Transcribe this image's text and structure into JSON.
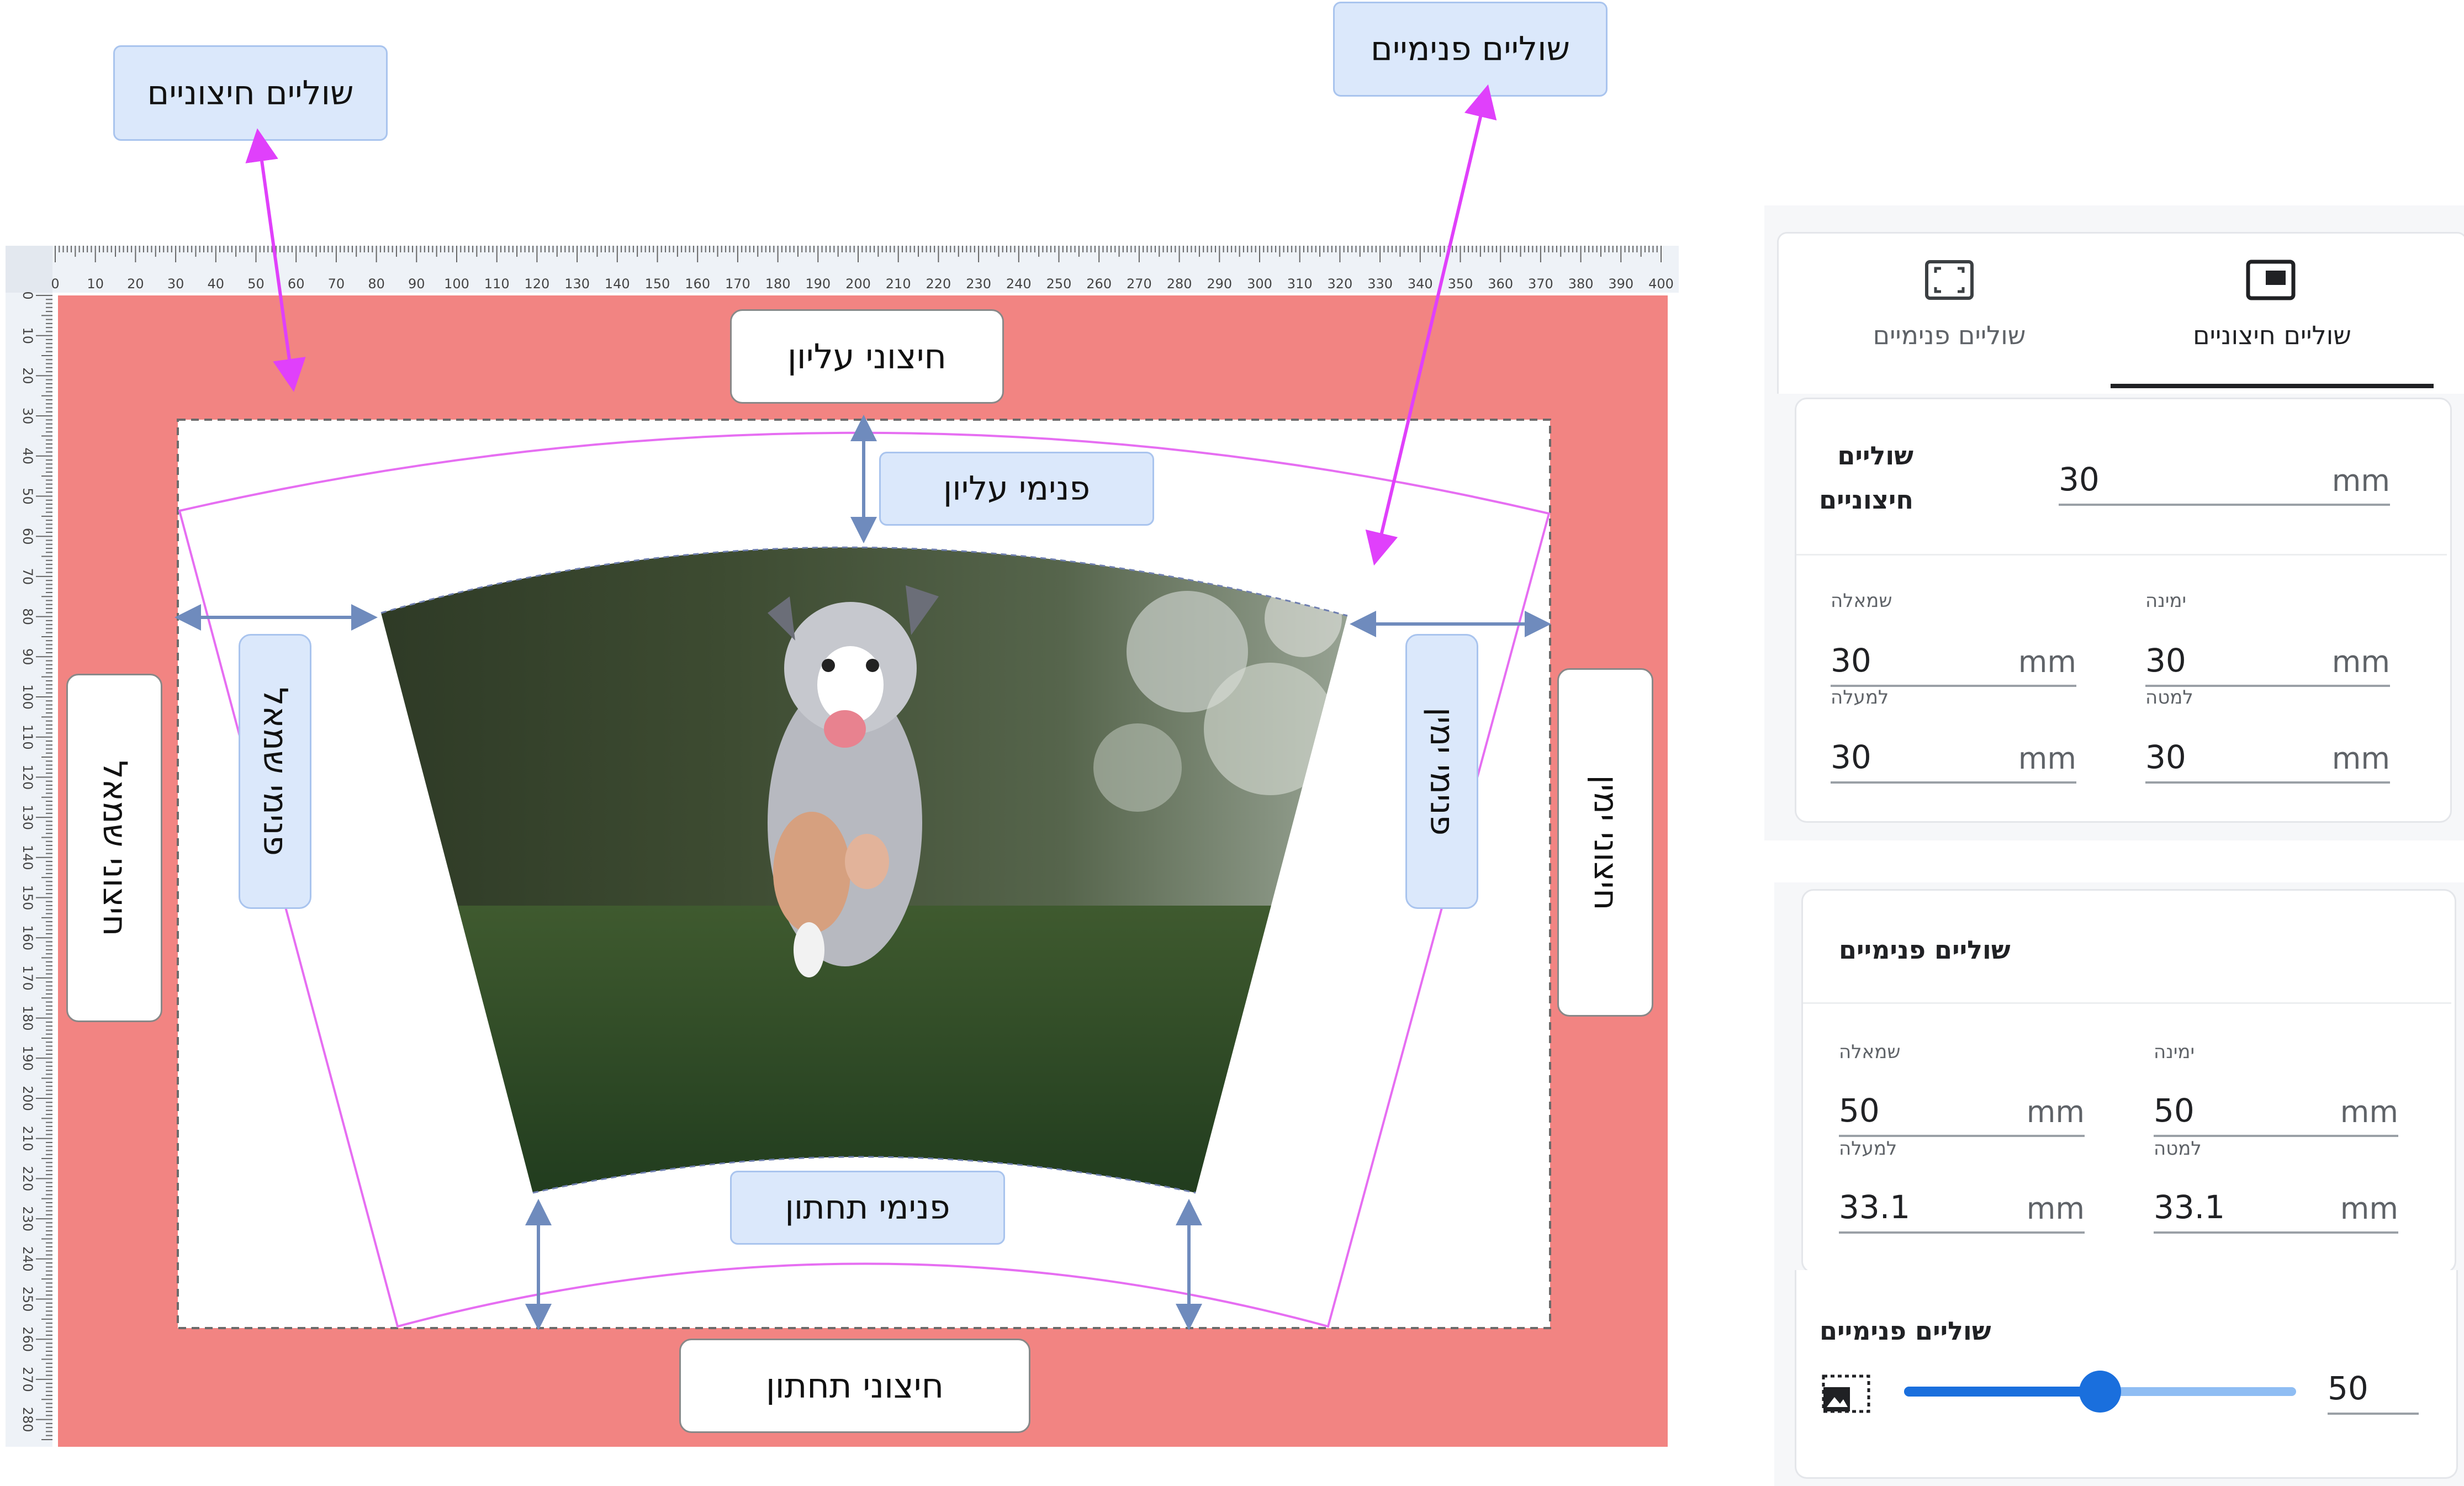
{
  "callouts": {
    "outer_margins": "שוליים חיצוניים",
    "inner_margins": "שוליים פנימיים"
  },
  "canvas": {
    "ruler_ticks": [
      "0",
      "10",
      "20",
      "30",
      "40",
      "50",
      "60",
      "70",
      "80",
      "90",
      "100",
      "110",
      "120",
      "130",
      "140",
      "150",
      "160",
      "170",
      "180",
      "190",
      "200",
      "210",
      "220",
      "230",
      "240",
      "250",
      "260",
      "270",
      "280",
      "290",
      "300",
      "310",
      "320",
      "330",
      "340",
      "350",
      "360",
      "370",
      "380",
      "390",
      "400"
    ],
    "ruler_v_ticks": [
      "0",
      "10",
      "20",
      "30",
      "40",
      "50",
      "60",
      "70",
      "80",
      "90",
      "100",
      "110",
      "120",
      "130",
      "140",
      "150",
      "160",
      "170",
      "180",
      "190",
      "200",
      "210",
      "220",
      "230",
      "240",
      "250",
      "260",
      "270",
      "280"
    ],
    "outer_top": "חיצוני עליון",
    "outer_bottom": "חיצוני תחתון",
    "outer_left": "חיצוני שמאל",
    "outer_right": "חיצוני ימין",
    "inner_top": "פנימי עליון",
    "inner_bottom": "פנימי תחתון",
    "inner_left": "פנימי שמאל",
    "inner_right": "פנימי ימין",
    "margin_color": "#f28482",
    "arrow_color": "#6f8bbd",
    "pointer_color": "#e040fb"
  },
  "outer_panel": {
    "tab_inner": "שוליים פנימיים",
    "tab_outer": "שוליים חיצוניים",
    "tab_inner_icon": "fit-frame-icon",
    "tab_outer_icon": "picture-in-picture-icon",
    "title_line1": "שוליים",
    "title_line2": "חיצוניים",
    "all_value": "30",
    "unit": "mm",
    "left_label": "שמאלה",
    "left_value": "30",
    "right_label": "ימינה",
    "right_value": "30",
    "top_label": "למעלה",
    "top_value": "30",
    "bottom_label": "למטה",
    "bottom_value": "30"
  },
  "inner_panel": {
    "title": "שוליים פנימיים",
    "unit": "mm",
    "left_label": "שמאלה",
    "left_value": "50",
    "right_label": "ימינה",
    "right_value": "50",
    "top_label": "למעלה",
    "top_value": "33.1",
    "bottom_label": "למטה",
    "bottom_value": "33.1",
    "slider_title": "שוליים פנימיים",
    "slider_icon": "image-frame-icon",
    "slider_value": "50",
    "slider_fraction": 0.5
  }
}
